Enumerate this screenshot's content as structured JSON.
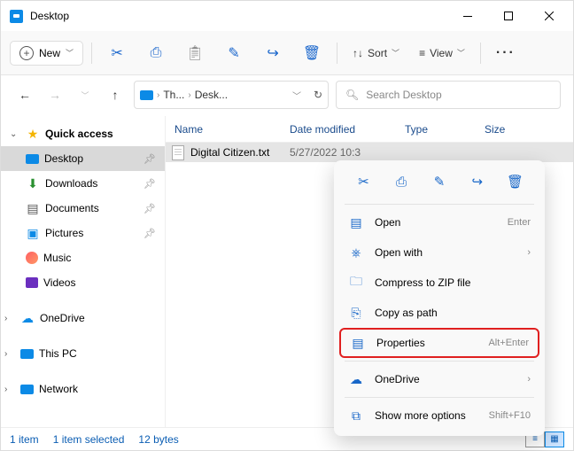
{
  "window": {
    "title": "Desktop"
  },
  "toolbar": {
    "new": "New",
    "sort": "Sort",
    "view": "View"
  },
  "breadcrumb": {
    "seg1": "Th...",
    "seg2": "Desk..."
  },
  "search": {
    "placeholder": "Search Desktop"
  },
  "sidebar": {
    "quickaccess": "Quick access",
    "desktop": "Desktop",
    "downloads": "Downloads",
    "documents": "Documents",
    "pictures": "Pictures",
    "music": "Music",
    "videos": "Videos",
    "onedrive": "OneDrive",
    "thispc": "This PC",
    "network": "Network"
  },
  "columns": {
    "name": "Name",
    "date": "Date modified",
    "type": "Type",
    "size": "Size"
  },
  "file": {
    "name": "Digital Citizen.txt",
    "date": "5/27/2022 10:3"
  },
  "status": {
    "count": "1 item",
    "selected": "1 item selected",
    "size": "12 bytes"
  },
  "ctx": {
    "open": "Open",
    "open_sc": "Enter",
    "openwith": "Open with",
    "compress": "Compress to ZIP file",
    "copypath": "Copy as path",
    "properties": "Properties",
    "properties_sc": "Alt+Enter",
    "onedrive": "OneDrive",
    "more": "Show more options",
    "more_sc": "Shift+F10"
  }
}
